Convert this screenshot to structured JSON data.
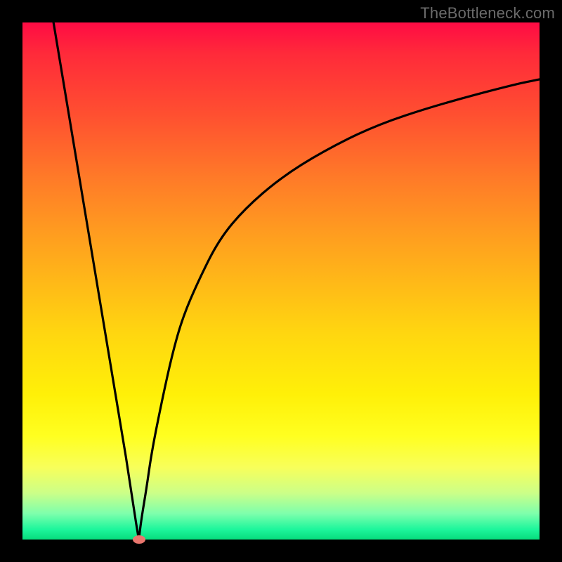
{
  "watermark": "TheBottleneck.com",
  "colors": {
    "background": "#000000",
    "curve": "#000000",
    "marker": "#e9766e"
  },
  "chart_data": {
    "type": "line",
    "title": "",
    "xlabel": "",
    "ylabel": "",
    "xlim": [
      0,
      100
    ],
    "ylim": [
      0,
      100
    ],
    "grid": false,
    "legend": false,
    "annotations": [
      {
        "type": "marker",
        "x": 22.5,
        "y": 0,
        "shape": "ellipse",
        "color": "#e9766e"
      }
    ],
    "series": [
      {
        "name": "left-branch",
        "x": [
          6,
          8,
          10,
          12,
          14,
          16,
          18,
          20,
          22,
          22.5
        ],
        "values": [
          100,
          88,
          76,
          64,
          52,
          40,
          28,
          16,
          3,
          0
        ]
      },
      {
        "name": "right-branch",
        "x": [
          22.5,
          23,
          24,
          25,
          27,
          29,
          31,
          34,
          38,
          43,
          50,
          58,
          68,
          80,
          95,
          100
        ],
        "values": [
          0,
          4,
          10,
          17,
          27,
          36,
          43,
          50,
          58,
          64,
          70,
          75,
          80,
          84,
          88,
          89
        ]
      }
    ]
  }
}
